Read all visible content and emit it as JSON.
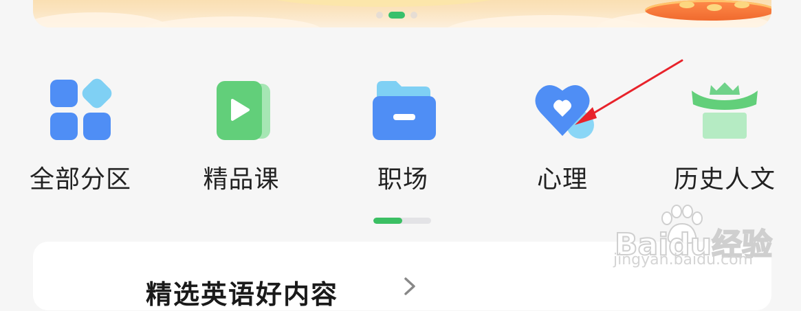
{
  "banner": {
    "carousel": {
      "count": 3,
      "active_index": 1
    }
  },
  "categories": [
    {
      "label": "全部分区",
      "icon": "grid-icon"
    },
    {
      "label": "精品课",
      "icon": "play-icon"
    },
    {
      "label": "职场",
      "icon": "folder-icon"
    },
    {
      "label": "心理",
      "icon": "heart-icon"
    },
    {
      "label": "历史人文",
      "icon": "pavilion-icon"
    }
  ],
  "category_scroll": {
    "position": 0.5
  },
  "section": {
    "title": "精选英语好内容"
  },
  "watermark": {
    "logo": "Baidu经验",
    "url": "jingyan.baidu.com"
  },
  "colors": {
    "accent_green": "#3bbf63",
    "icon_blue": "#4f8ef5",
    "icon_green": "#62cf7a",
    "annotation_red": "#e8232b"
  }
}
